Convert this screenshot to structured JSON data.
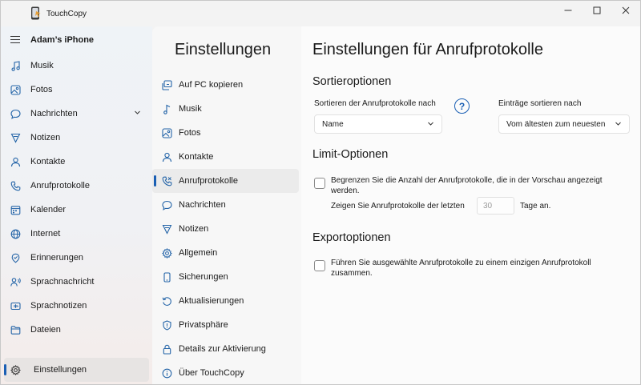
{
  "app": {
    "title": "TouchCopy",
    "window_controls": [
      "minimize",
      "maximize",
      "close"
    ]
  },
  "sidebar": {
    "device_name": "Adam’s iPhone",
    "items": [
      {
        "label": "Musik",
        "icon": "music-note-icon"
      },
      {
        "label": "Fotos",
        "icon": "photo-icon"
      },
      {
        "label": "Nachrichten",
        "icon": "chat-icon",
        "expandable": true
      },
      {
        "label": "Notizen",
        "icon": "notes-icon"
      },
      {
        "label": "Kontakte",
        "icon": "contact-icon"
      },
      {
        "label": "Anrufprotokolle",
        "icon": "phone-icon"
      },
      {
        "label": "Kalender",
        "icon": "calendar-icon"
      },
      {
        "label": "Internet",
        "icon": "globe-icon"
      },
      {
        "label": "Erinnerungen",
        "icon": "reminder-icon"
      },
      {
        "label": "Sprachnachricht",
        "icon": "voicemail-icon"
      },
      {
        "label": "Sprachnotizen",
        "icon": "voice-memo-icon"
      },
      {
        "label": "Dateien",
        "icon": "folder-icon"
      }
    ],
    "settings_label": "Einstellungen"
  },
  "settings_menu": {
    "title": "Einstellungen",
    "items": [
      {
        "label": "Auf PC kopieren",
        "icon": "copy-to-pc-icon"
      },
      {
        "label": "Musik",
        "icon": "music-note-icon"
      },
      {
        "label": "Fotos",
        "icon": "photo-icon"
      },
      {
        "label": "Kontakte",
        "icon": "contact-icon"
      },
      {
        "label": "Anrufprotokolle",
        "icon": "phone-icon",
        "active": true
      },
      {
        "label": "Nachrichten",
        "icon": "chat-icon"
      },
      {
        "label": "Notizen",
        "icon": "notes-icon"
      },
      {
        "label": "Allgemein",
        "icon": "gear-icon"
      },
      {
        "label": "Sicherungen",
        "icon": "backup-icon"
      },
      {
        "label": "Aktualisierungen",
        "icon": "refresh-icon"
      },
      {
        "label": "Privatsphäre",
        "icon": "shield-icon"
      },
      {
        "label": "Details zur Aktivierung",
        "icon": "lock-icon"
      },
      {
        "label": "Über TouchCopy",
        "icon": "info-icon"
      }
    ]
  },
  "content": {
    "title": "Einstellungen für Anrufprotokolle",
    "sort": {
      "heading": "Sortieroptionen",
      "sort_by_label": "Sortieren der Anrufprotokolle nach",
      "sort_by_value": "Name",
      "order_label": "Einträge sortieren nach",
      "order_value": "Vom ältesten zum neuesten",
      "help": "?"
    },
    "limit": {
      "heading": "Limit-Optionen",
      "checkbox_label": "Begrenzen Sie die Anzahl der Anrufprotokolle, die in der Vorschau angezeigt werden.",
      "show_prefix": "Zeigen Sie Anrufprotokolle der letzten",
      "count_placeholder": "30",
      "show_suffix": "Tage an.",
      "checked": false
    },
    "export": {
      "heading": "Exportoptionen",
      "checkbox_label": "Führen Sie ausgewählte Anrufprotokolle zu einem einzigen Anrufprotokoll zusammen.",
      "checked": false
    }
  }
}
